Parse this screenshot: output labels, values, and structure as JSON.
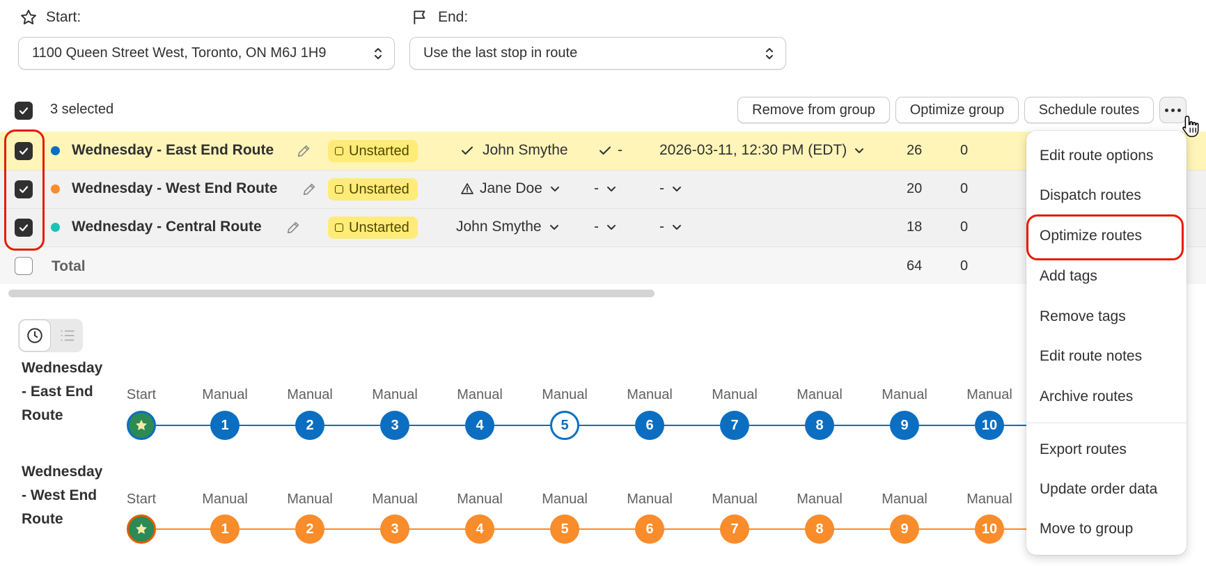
{
  "start": {
    "label": "Start:",
    "value": "1100 Queen Street West, Toronto, ON M6J 1H9"
  },
  "end": {
    "label": "End:",
    "value": "Use the last stop in route"
  },
  "selection": {
    "count_label": "3 selected"
  },
  "actions": {
    "remove_from_group": "Remove from group",
    "optimize_group": "Optimize group",
    "schedule_routes": "Schedule routes"
  },
  "routes": [
    {
      "color": "#0b6ec1",
      "name": "Wednesday - East End Route",
      "status": "Unstarted",
      "driver": "John Smythe",
      "vehicle": "-",
      "start_time": "2026-03-11, 12:30 PM (EDT)",
      "stops": "26",
      "second": "0"
    },
    {
      "color": "#f98c2b",
      "name": "Wednesday - West End Route",
      "status": "Unstarted",
      "driver": "Jane Doe",
      "vehicle": "-",
      "start_time": "-",
      "stops": "20",
      "second": "0"
    },
    {
      "color": "#1cc1b8",
      "name": "Wednesday - Central Route",
      "status": "Unstarted",
      "driver": "John Smythe",
      "vehicle": "-",
      "start_time": "-",
      "stops": "18",
      "second": "0"
    }
  ],
  "total": {
    "label": "Total",
    "stops": "64",
    "second": "0"
  },
  "timelines": [
    {
      "name_lines": [
        "Wednesday",
        "- East End",
        "Route"
      ],
      "color": "#0b6ec1",
      "start_label": "Start",
      "stop_caption": "Manual",
      "stops": [
        "1",
        "2",
        "3",
        "4",
        "5",
        "6",
        "7",
        "8",
        "9",
        "10"
      ]
    },
    {
      "name_lines": [
        "Wednesday",
        "- West End",
        "Route"
      ],
      "color": "#f98c2b",
      "start_label": "Start",
      "stop_caption": "Manual",
      "stops": [
        "1",
        "2",
        "3",
        "4",
        "5",
        "6",
        "7",
        "8",
        "9",
        "10"
      ]
    }
  ],
  "menu": {
    "items": [
      "Edit route options",
      "Dispatch routes",
      "Optimize routes",
      "Add tags",
      "Remove tags",
      "Edit route notes",
      "Archive routes",
      "Export routes",
      "Update order data",
      "Move to group"
    ]
  }
}
